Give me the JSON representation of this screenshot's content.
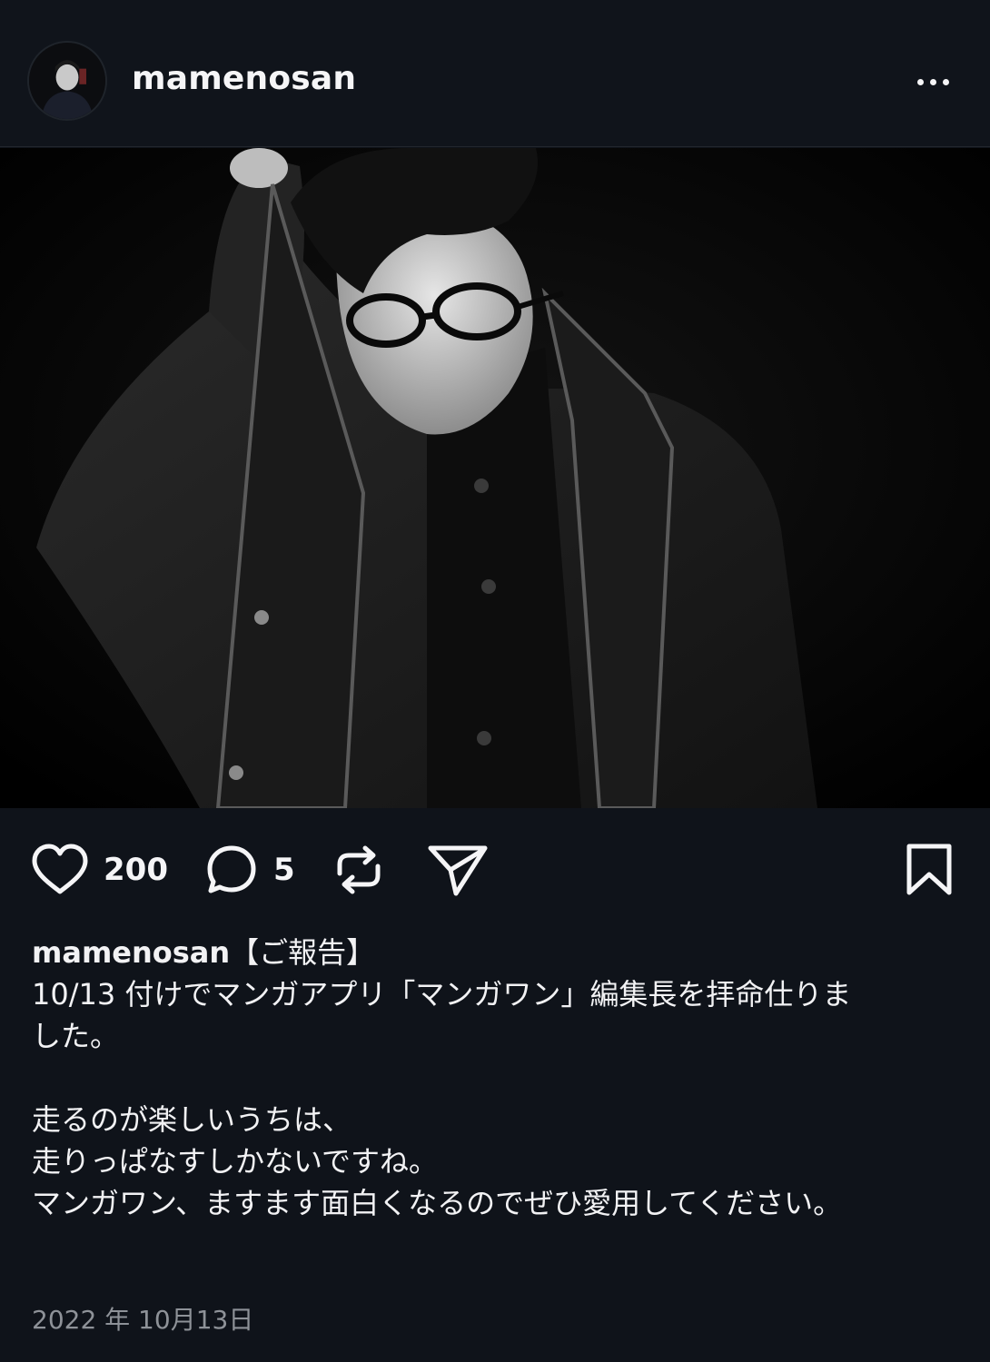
{
  "post": {
    "username": "mamenosan",
    "likes": "200",
    "comments": "5",
    "caption_user": "mamenosan",
    "caption_head": "【ご報告】",
    "caption_lines": [
      "10/13 付けでマンガアプリ「マンガワン」編集長を拝命仕りま",
      "した。",
      "",
      "走るのが楽しいうちは、",
      "走りっぱなすしかないですね。",
      "",
      "マンガワン、ますます面白くなるのでぜひ愛用してください。"
    ],
    "date": "2022 年 10月13日"
  },
  "icons": {
    "more": "more-options-icon",
    "like": "heart-icon",
    "comment": "comment-bubble-icon",
    "repost": "repost-icon",
    "share": "send-icon",
    "save": "bookmark-icon"
  },
  "colors": {
    "background": "#0f131a",
    "text": "#f5f5f7",
    "muted": "#8e9298"
  }
}
